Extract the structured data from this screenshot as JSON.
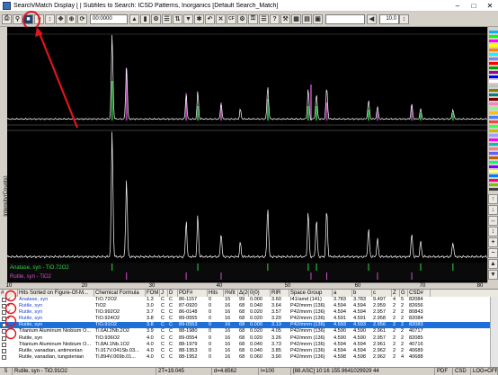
{
  "window": {
    "title": "Search/Match Display [ | Subfiles to Search: ICSD Patterns, Inorganics [Default Search_Match]"
  },
  "toolbar": {
    "dropdown_value": "00:0000",
    "zoom_value": "10.0"
  },
  "plot": {
    "y_axis_label": "Intensity(Counts)",
    "x_ticks": [
      "10",
      "20",
      "30",
      "40",
      "50",
      "60",
      "70",
      "80"
    ],
    "legend_rows": [
      "Anatase, syn - TiO.72O2",
      "Rutile, syn - TiO2"
    ]
  },
  "colors": {
    "anatase": "#2ed640",
    "rutile": "#d24ed0",
    "selected": "#1e6fd8",
    "annotation": "#e0141c"
  },
  "hits_table": {
    "columns": [
      "#",
      "Hits Sorted on Figure-Of-M...",
      "Chemical Formula",
      "FOM",
      "J",
      "D",
      "PDF#",
      "Hits",
      "I%fit",
      "Δ(2θ)",
      "0(0)",
      "RIR",
      "Space Group",
      "a",
      "b",
      "c",
      "Z",
      "G",
      "CSD#"
    ],
    "rows": [
      {
        "check": "✓",
        "name": "Anatase, syn",
        "formula": "TiO.72O2",
        "fom": "1.3",
        "j": "C",
        "d": "C",
        "pdf": "86-1157",
        "hits": "0",
        "ifit": "15",
        "d2t": "99",
        "zero": "0.000",
        "rir": "3.60",
        "sg": "I41/amd (141)",
        "a": "3.783",
        "b": "3.783",
        "c": "9.497",
        "z": "4",
        "g": "5",
        "csd": "82084"
      },
      {
        "check": "✓",
        "name": "Rutile, syn",
        "formula": "TiO2",
        "fom": "3.0",
        "j": "C",
        "d": "C",
        "pdf": "87-0920",
        "hits": "0",
        "ifit": "16",
        "d2t": "68",
        "zero": "0.040",
        "rir": "3.64",
        "sg": "P42/mnm (136)",
        "a": "4.594",
        "b": "4.594",
        "c": "2.959",
        "z": "2",
        "g": "2",
        "csd": "82656"
      },
      {
        "check": "✓",
        "name": "Rutile, syn",
        "formula": "TiO.992O2",
        "fom": "3.7",
        "j": "C",
        "d": "C",
        "pdf": "86-0148",
        "hits": "0",
        "ifit": "16",
        "d2t": "68",
        "zero": "0.020",
        "rir": "3.57",
        "sg": "P42/mnm (136)",
        "a": "4.594",
        "b": "4.594",
        "c": "2.957",
        "z": "2",
        "g": "2",
        "csd": "80843"
      },
      {
        "check": "✓",
        "name": "Rutile, syn",
        "formula": "TiO.924O2",
        "fom": "3.8",
        "j": "C",
        "d": "C",
        "pdf": "89-0555",
        "hits": "0",
        "ifit": "16",
        "d2t": "68",
        "zero": "0.020",
        "rir": "3.20",
        "sg": "P42/mnm (136)",
        "a": "4.591",
        "b": "4.591",
        "c": "2.958",
        "z": "2",
        "g": "2",
        "csd": "82084"
      },
      {
        "check": "",
        "name": "Rutile, syn",
        "formula": "TiO.91O2",
        "fom": "3.8",
        "j": "C",
        "d": "C",
        "pdf": "89-0553",
        "hits": "0",
        "ifit": "16",
        "d2t": "68",
        "zero": "0.000",
        "rir": "3.13",
        "sg": "P42/mnm (136)",
        "a": "4.593",
        "b": "4.593",
        "c": "2.956",
        "z": "2",
        "g": "2",
        "csd": "82083"
      },
      {
        "check": "",
        "name": "Titanium Aluminum Niobium O...",
        "formula": "Ti.6Al.2Nb.2O2",
        "fom": "3.9",
        "j": "C",
        "d": "C",
        "pdf": "88-1980",
        "hits": "0",
        "ifit": "16",
        "d2t": "68",
        "zero": "0.020",
        "rir": "4.05",
        "sg": "P42/mnm (136)",
        "a": "4.590",
        "b": "4.590",
        "c": "2.961",
        "z": "2",
        "g": "2",
        "csd": "40717"
      },
      {
        "check": "",
        "name": "Rutile, syn",
        "formula": "TiO.936O2",
        "fom": "4.0",
        "j": "C",
        "d": "C",
        "pdf": "89-0554",
        "hits": "0",
        "ifit": "16",
        "d2t": "68",
        "zero": "0.020",
        "rir": "3.26",
        "sg": "P42/mnm (136)",
        "a": "4.590",
        "b": "4.590",
        "c": "2.957",
        "z": "2",
        "g": "2",
        "csd": "82085"
      },
      {
        "check": "",
        "name": "Titanium Aluminum Niobium O...",
        "formula": "Ti.8Al.1Nb.1O2",
        "fom": "4.0",
        "j": "C",
        "d": "C",
        "pdf": "88-1979",
        "hits": "0",
        "ifit": "16",
        "d2t": "68",
        "zero": "0.040",
        "rir": "3.73",
        "sg": "P42/mnm (136)",
        "a": "4.594",
        "b": "4.594",
        "c": "2.961",
        "z": "2",
        "g": "2",
        "csd": "40716"
      },
      {
        "check": "",
        "name": "Rutile, vanadian, antimonian",
        "formula": "Ti.917V.041Sb.03...",
        "fom": "4.0",
        "j": "C",
        "d": "C",
        "pdf": "88-1953",
        "hits": "0",
        "ifit": "16",
        "d2t": "68",
        "zero": "0.040",
        "rir": "3.85",
        "sg": "P42/mnm (136)",
        "a": "4.594",
        "b": "4.594",
        "c": "2.962",
        "z": "2",
        "g": "2",
        "csd": "40689"
      },
      {
        "check": "",
        "name": "Rutile, vanadian, tungstenian",
        "formula": "Ti.894V.069b.01...",
        "fom": "4.0",
        "j": "C",
        "d": "C",
        "pdf": "88-1952",
        "hits": "0",
        "ifit": "16",
        "d2t": "68",
        "zero": "0.060",
        "rir": "3.90",
        "sg": "P42/mnm (136)",
        "a": "4.598",
        "b": "4.598",
        "c": "2.962",
        "z": "2",
        "g": "4",
        "csd": "40688"
      }
    ]
  },
  "status": {
    "count": "5",
    "selected": "Rutile, syn - TiO.91O2",
    "two_theta": "2T=19.045",
    "d": "d=4.6562",
    "i": "I=100",
    "info": "[88.ASC] 10:16 155.9641029929 44",
    "pdf": "PDF",
    "csd": "CSD",
    "log": "LOG=OFF"
  }
}
